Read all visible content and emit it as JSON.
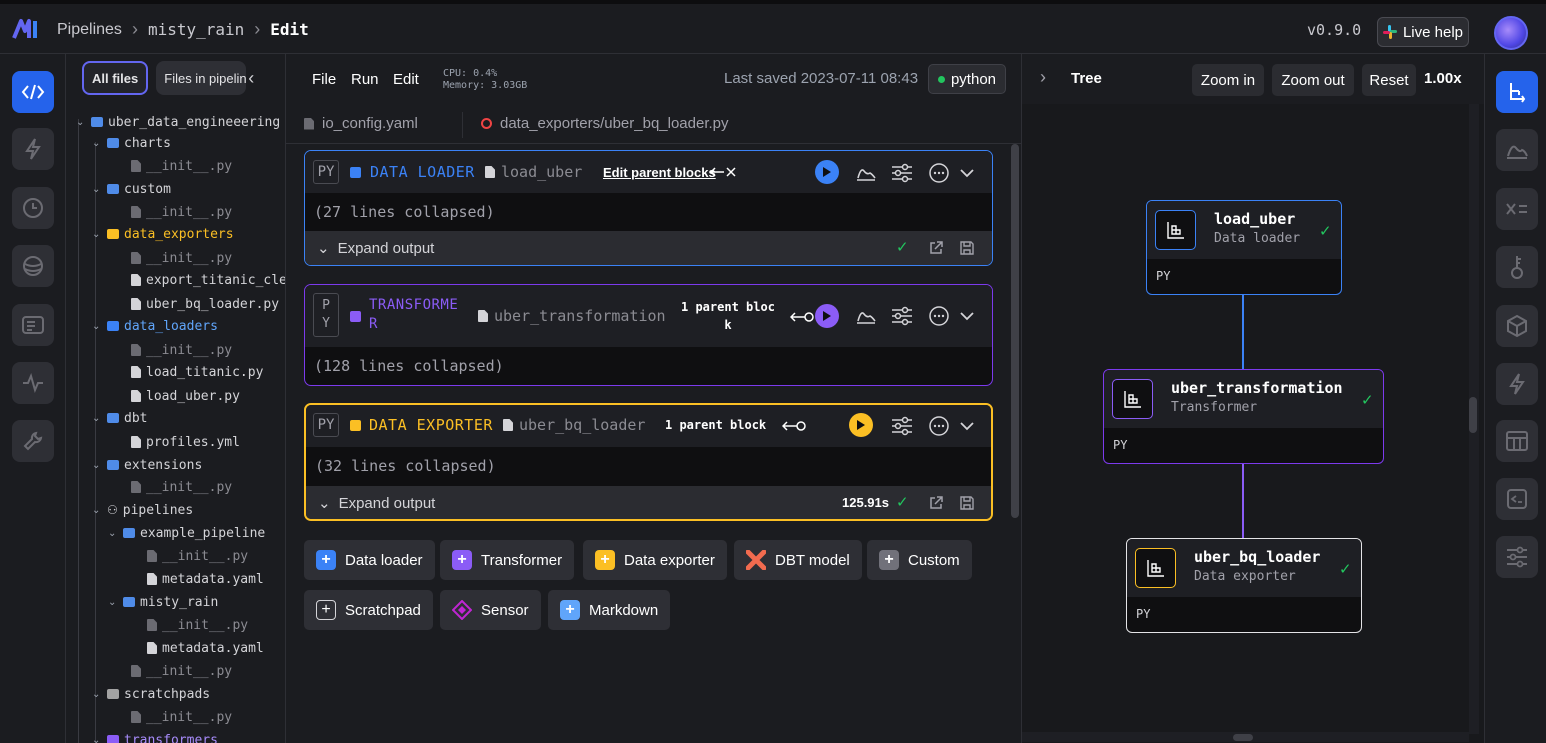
{
  "header": {
    "breadcrumb": [
      "Pipelines",
      "misty_rain",
      "Edit"
    ],
    "version": "v0.9.0",
    "live_help": "Live help"
  },
  "left_rail": {
    "items": [
      "code-icon",
      "lightning-icon",
      "clock-icon",
      "globe-icon",
      "terminal-icon",
      "heartbeat-icon",
      "wrench-icon"
    ],
    "active": 0
  },
  "right_rail": {
    "items": [
      "tree-icon",
      "chart-icon",
      "variables-icon",
      "key-icon",
      "cube-icon",
      "lightning-icon",
      "table-icon",
      "terminal-icon",
      "settings-icon"
    ],
    "active": 0
  },
  "file_panel": {
    "tabs": [
      "All files",
      "Files in pipeline"
    ],
    "tree": [
      {
        "label": "uber_data_engineeering",
        "kind": "folder",
        "level": 0
      },
      {
        "label": "charts",
        "kind": "folder",
        "level": 1
      },
      {
        "label": "__init__.py",
        "kind": "file-dim",
        "level": 2
      },
      {
        "label": "custom",
        "kind": "folder",
        "level": 1
      },
      {
        "label": "__init__.py",
        "kind": "file-dim",
        "level": 2
      },
      {
        "label": "data_exporters",
        "kind": "yellow",
        "level": 1
      },
      {
        "label": "__init__.py",
        "kind": "file-dim",
        "level": 2
      },
      {
        "label": "export_titanic_clea",
        "kind": "file",
        "level": 2
      },
      {
        "label": "uber_bq_loader.py",
        "kind": "file",
        "level": 2
      },
      {
        "label": "data_loaders",
        "kind": "blue",
        "level": 1
      },
      {
        "label": "__init__.py",
        "kind": "file-dim",
        "level": 2
      },
      {
        "label": "load_titanic.py",
        "kind": "file",
        "level": 2
      },
      {
        "label": "load_uber.py",
        "kind": "file",
        "level": 2
      },
      {
        "label": "dbt",
        "kind": "folder",
        "level": 1
      },
      {
        "label": "profiles.yml",
        "kind": "file",
        "level": 2
      },
      {
        "label": "extensions",
        "kind": "folder",
        "level": 1
      },
      {
        "label": "__init__.py",
        "kind": "file-dim",
        "level": 2
      },
      {
        "label": "pipelines",
        "kind": "pipelines",
        "level": 1
      },
      {
        "label": "example_pipeline",
        "kind": "folder",
        "level": 2
      },
      {
        "label": "__init__.py",
        "kind": "file-dim",
        "level": 3
      },
      {
        "label": "metadata.yaml",
        "kind": "file",
        "level": 3
      },
      {
        "label": "misty_rain",
        "kind": "folder",
        "level": 2
      },
      {
        "label": "__init__.py",
        "kind": "file-dim",
        "level": 3
      },
      {
        "label": "metadata.yaml",
        "kind": "file",
        "level": 3
      },
      {
        "label": "__init__.py",
        "kind": "file-dim",
        "level": 2
      },
      {
        "label": "scratchpads",
        "kind": "gray",
        "level": 1
      },
      {
        "label": "__init__.py",
        "kind": "file-dim",
        "level": 2
      },
      {
        "label": "transformers",
        "kind": "purple",
        "level": 1
      }
    ]
  },
  "editor": {
    "menu": [
      "File",
      "Run",
      "Edit"
    ],
    "cpu": "CPU: 0.4%",
    "memory": "Memory: 3.03GB",
    "last_saved": "Last saved 2023-07-11 08:43",
    "kernel": "python",
    "file_tabs": [
      "io_config.yaml",
      "data_exporters/uber_bq_loader.py"
    ],
    "blocks": [
      {
        "lang": "PY",
        "type": "DATA LOADER",
        "name": "load_uber",
        "parent": "Edit parent blocks",
        "collapsed": "(27 lines collapsed)",
        "expand": "Expand output",
        "runtime": "",
        "color": "#3b82f6"
      },
      {
        "lang": "P\nY",
        "type": "TRANSFORME\nR",
        "name": "uber_transformation",
        "parent": "1 parent bloc\nk",
        "collapsed": "(128 lines collapsed)",
        "color": "#8b5cf6"
      },
      {
        "lang": "PY",
        "type": "DATA EXPORTER",
        "name": "uber_bq_loader",
        "parent": "1 parent block",
        "collapsed": "(32 lines collapsed)",
        "expand": "Expand output",
        "runtime": "125.91s",
        "color": "#fbbf24"
      }
    ],
    "add_buttons": [
      {
        "label": "Data loader",
        "color": "#3b82f6",
        "glyph": "+"
      },
      {
        "label": "Transformer",
        "color": "#8b5cf6",
        "glyph": "+"
      },
      {
        "label": "Data exporter",
        "color": "#fbbf24",
        "glyph": "+"
      },
      {
        "label": "DBT model",
        "color": "#f26b4f",
        "glyph": "dbt"
      },
      {
        "label": "Custom",
        "color": "#71717a",
        "glyph": "+"
      },
      {
        "label": "Scratchpad",
        "color": "#2e2f35",
        "glyph": "+"
      },
      {
        "label": "Sensor",
        "color": "#c026d3",
        "glyph": "◇"
      },
      {
        "label": "Markdown",
        "color": "#60a5fa",
        "glyph": "+"
      }
    ]
  },
  "tree_panel": {
    "title": "Tree",
    "zoom_in": "Zoom in",
    "zoom_out": "Zoom out",
    "reset": "Reset",
    "zoom_level": "1.00x",
    "nodes": [
      {
        "name": "load_uber",
        "type": "Data loader",
        "lang": "PY",
        "color": "#3b82f6"
      },
      {
        "name": "uber_transformation",
        "type": "Transformer",
        "lang": "PY",
        "color": "#8b5cf6"
      },
      {
        "name": "uber_bq_loader",
        "type": "Data exporter",
        "lang": "PY",
        "color": "#fbbf24"
      }
    ]
  },
  "colors": {
    "accent": "#2563eb",
    "loader": "#3b82f6",
    "transformer": "#8b5cf6",
    "exporter": "#fbbf24",
    "success": "#22c55e"
  }
}
